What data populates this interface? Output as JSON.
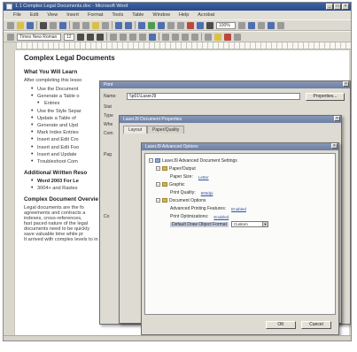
{
  "window": {
    "title": "1.1 Complex Legal Documents.doc - Microsoft Word"
  },
  "menu": [
    "File",
    "Edit",
    "View",
    "Insert",
    "Format",
    "Tools",
    "Table",
    "Window",
    "Help",
    "Acrobat"
  ],
  "toolbar": {
    "style_select": "Times New Roman",
    "zoom": "100%",
    "font_size": "12"
  },
  "document": {
    "title": "Complex Legal Documents",
    "section1_heading": "What You Will Learn",
    "section1_intro": "After completing this lesso",
    "bullets": [
      "Use the Document",
      "Generate a Table o",
      "Entries",
      "Use the Style Separ",
      "Update a Table of",
      "Generate and Upd",
      "Mark Index Entries",
      "Insert and Edit Cro",
      "Insert and Edit Foo",
      "Insert and Update",
      "Troubleshoot Com"
    ],
    "section2_heading": "Additional Written Reso",
    "resources": [
      "Word 2003 For Le",
      "3004+ and Rastes"
    ],
    "section3_heading": "Complex Document Overvie",
    "paragraph_lines": [
      "Legal documents are the fo",
      "agreements and contracts a",
      "indexes, cross-references,",
      "fast paced nature of the legal",
      "documents need to be quickly",
      "save valuable time while pr"
    ],
    "footer_line": "It arrived with complex levels to in which will be in the amount of fewer th"
  },
  "print_dialog": {
    "title": "Print",
    "name_label": "Name:",
    "name_value": "\\\\p01\\LaserJ9",
    "properties_button": "Properties...",
    "status_label": "Stat",
    "type_label": "Type",
    "where_label": "Whe",
    "comment_label": "Com",
    "page_range_label": "Pag",
    "copies_label": "Co"
  },
  "props_dialog": {
    "title": "LaserJ9 Document Properties",
    "tabs": [
      "Layout",
      "Paper/Quality"
    ]
  },
  "adv_dialog": {
    "title": "LaserJ9 Advanced Options",
    "tree": {
      "root": "LaserJ9 Advanced Document Settings",
      "paper_output": "Paper/Output",
      "paper_size_label": "Paper Size:",
      "paper_size_value": "Letter",
      "graphic": "Graphic",
      "print_quality_label": "Print Quality:",
      "print_quality_value": "600dpi",
      "document_options": "Document Options",
      "advanced_features_label": "Advanced Printing Features:",
      "advanced_features_value": "Enabled",
      "print_optimizations_label": "Print Optimizations:",
      "print_optimizations_value": "Enabled",
      "default_format_label": "Default Draw Object Format",
      "default_format_value": "Custom"
    },
    "ok_button": "OK",
    "cancel_button": "Cancel"
  }
}
